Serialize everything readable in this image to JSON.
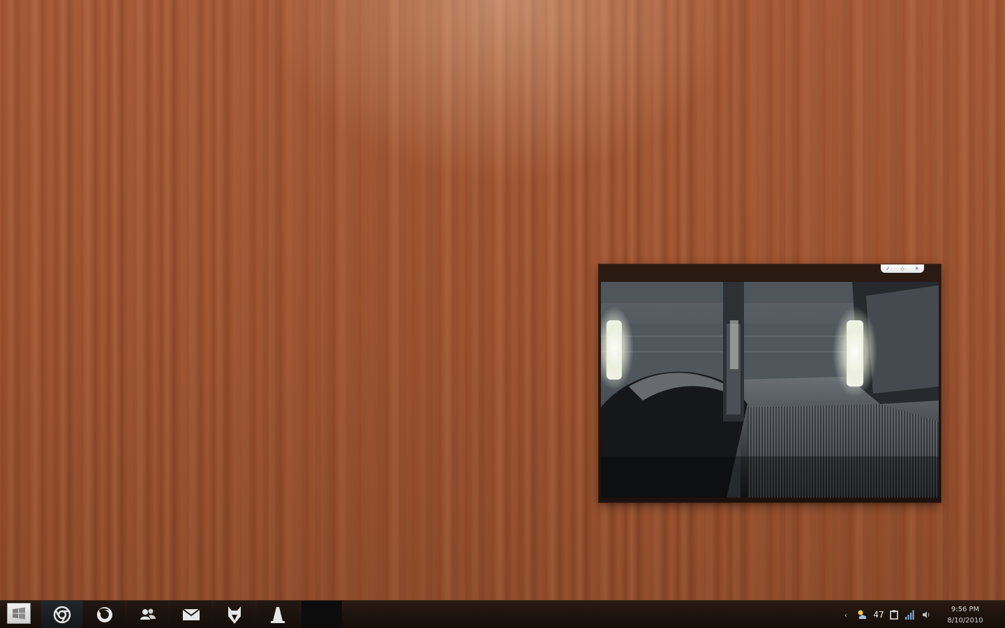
{
  "desktop": {
    "wallpaper": "wood-planks",
    "accent_color": "#a45834"
  },
  "gadget": {
    "type": "slideshow",
    "toolbar": {
      "buttons": [
        {
          "icon": "wrench-icon",
          "glyph": "✓"
        },
        {
          "icon": "drag-icon",
          "glyph": "◇"
        },
        {
          "icon": "close-icon",
          "glyph": "✕"
        }
      ]
    },
    "photo": "escalator"
  },
  "taskbar": {
    "start_icon": "windows-logo-icon",
    "pinned": [
      {
        "name": "chrome",
        "icon": "chrome-icon"
      },
      {
        "name": "firefox",
        "icon": "firefox-icon"
      },
      {
        "name": "contacts",
        "icon": "people-icon"
      },
      {
        "name": "mail",
        "icon": "envelope-icon"
      },
      {
        "name": "foxit",
        "icon": "fox-icon"
      },
      {
        "name": "vlc",
        "icon": "cone-icon"
      }
    ],
    "tray": {
      "show_hidden": "‹",
      "temperature": "47",
      "icons": [
        "weather-icon",
        "clipboard-icon",
        "network-signal-icon",
        "volume-icon"
      ]
    },
    "clock": {
      "time": "9:56 PM",
      "date": "8/10/2010"
    }
  }
}
